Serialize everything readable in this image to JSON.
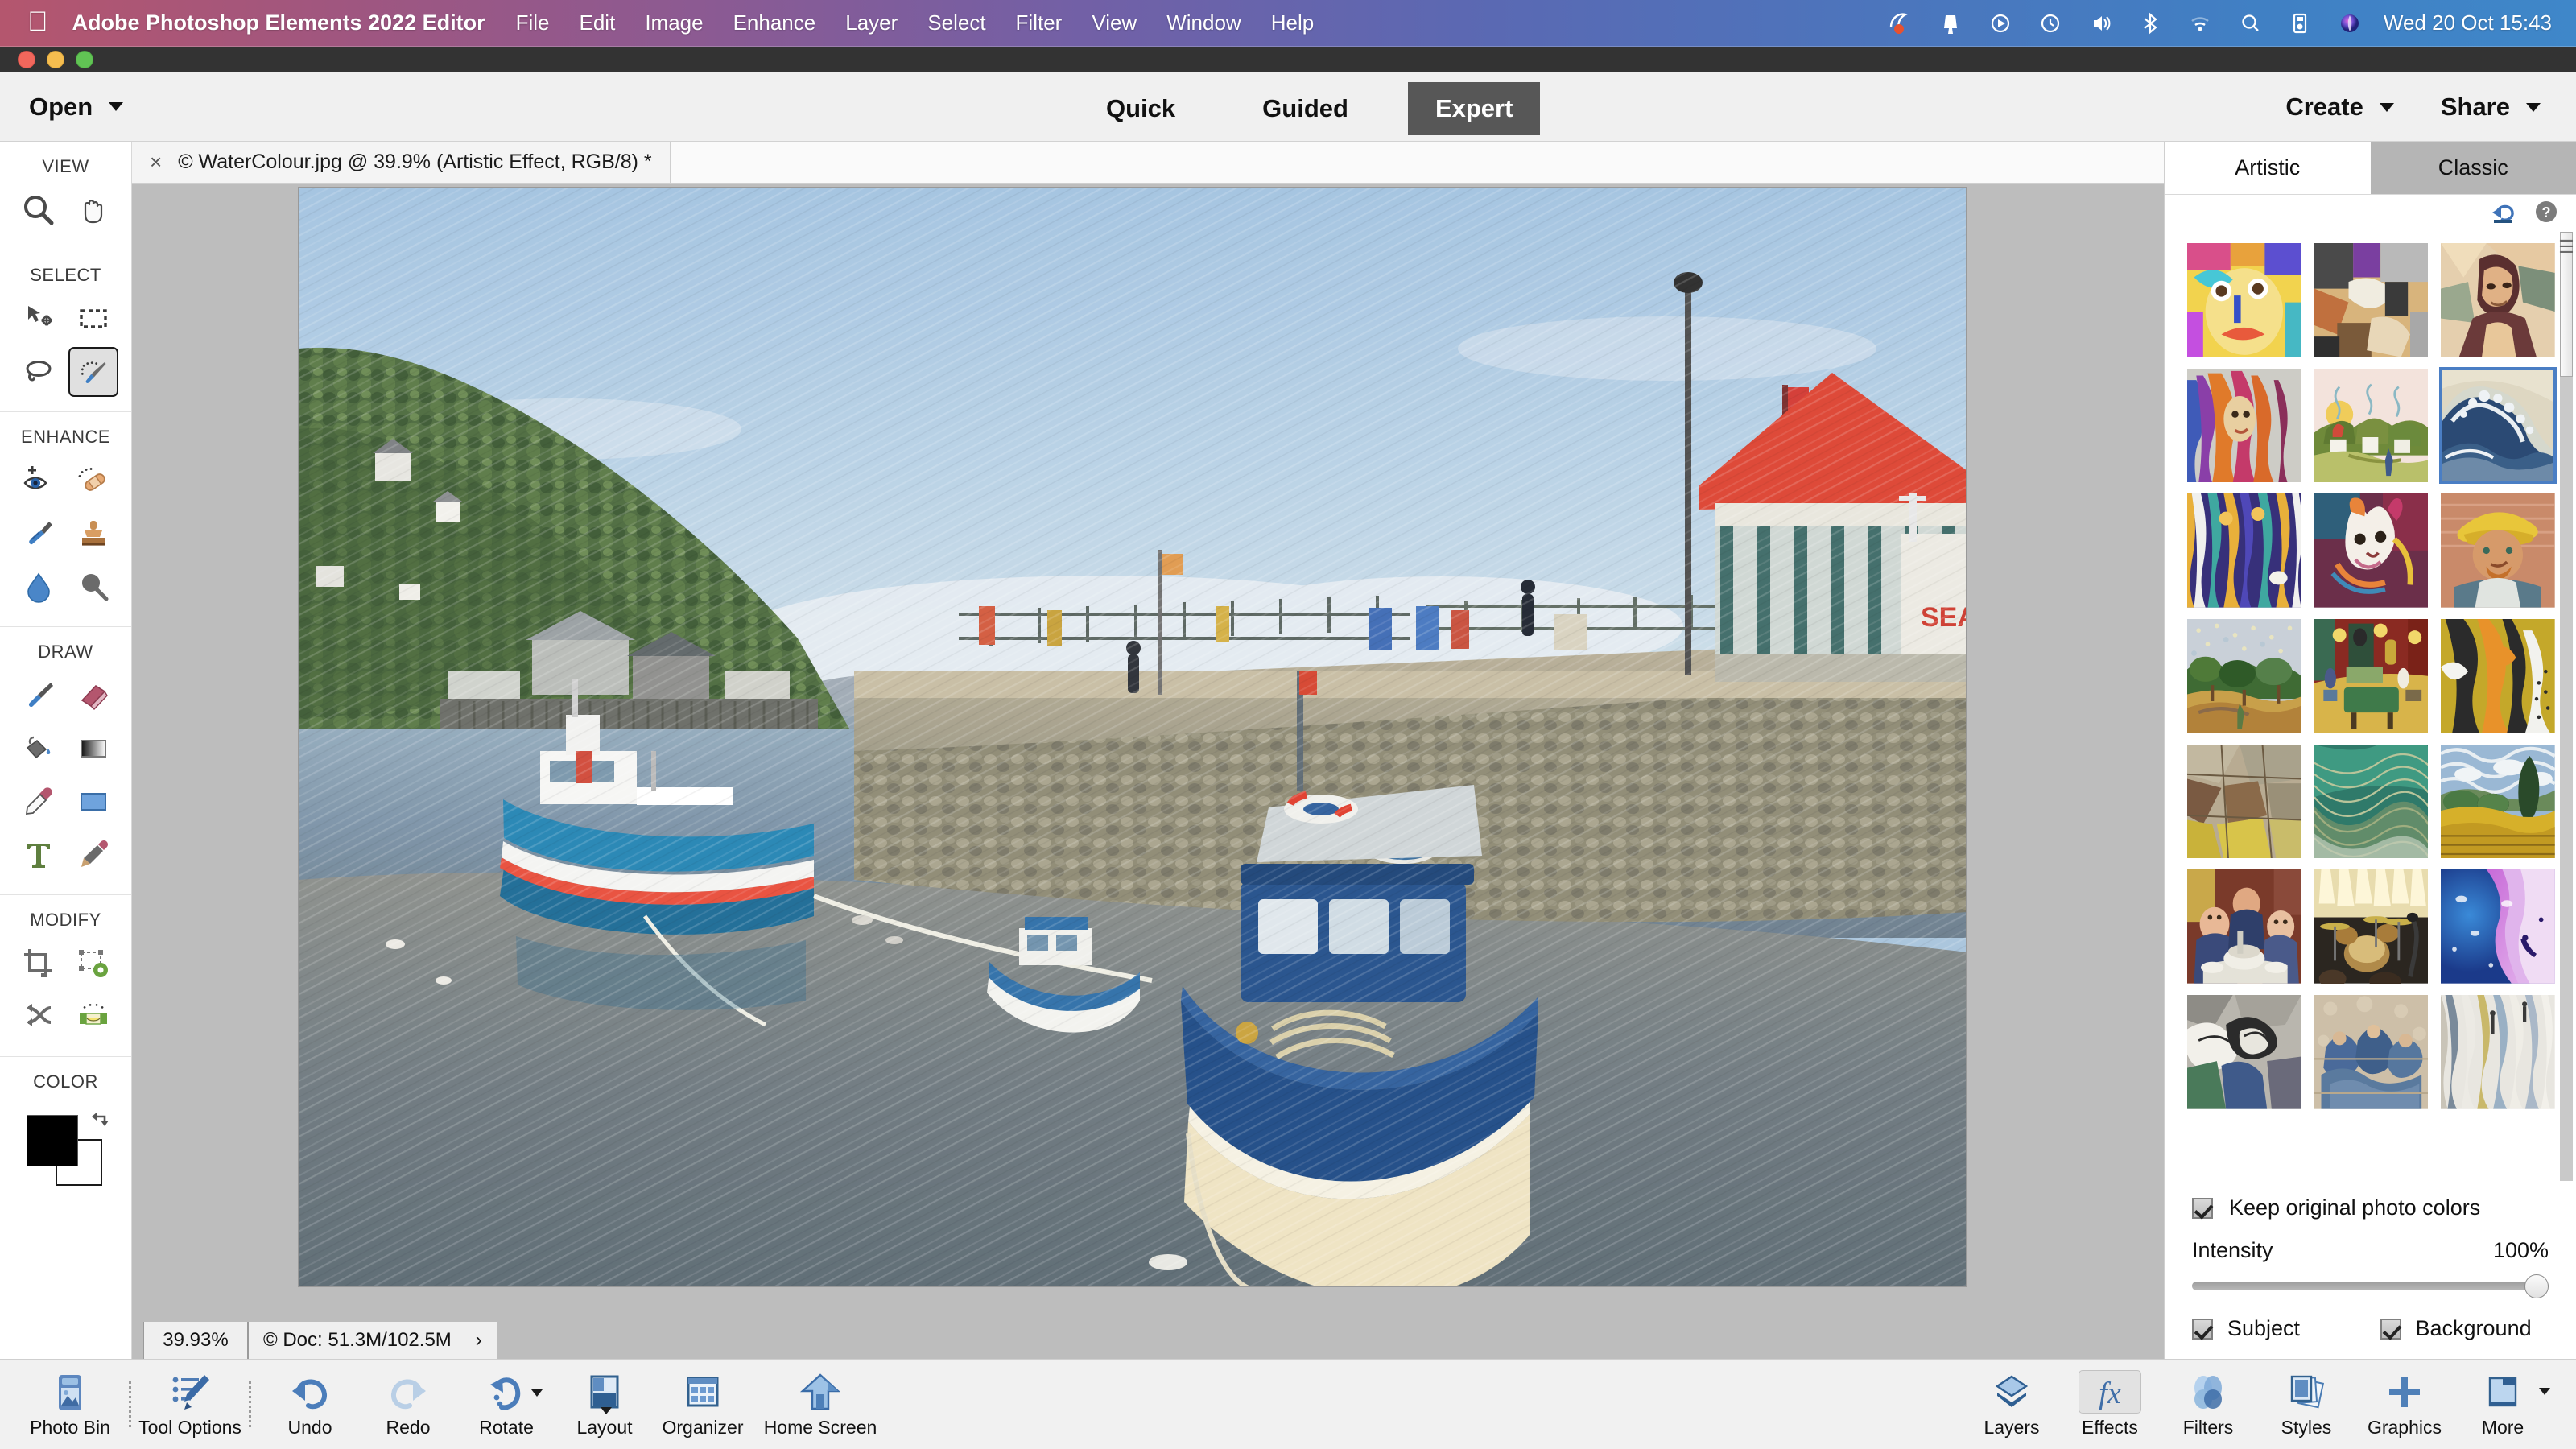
{
  "menubar": {
    "apple_icon": "apple-icon",
    "app_name": "Adobe Photoshop Elements 2022 Editor",
    "items": [
      "File",
      "Edit",
      "Image",
      "Enhance",
      "Layer",
      "Select",
      "Filter",
      "View",
      "Window",
      "Help"
    ],
    "status_icons": [
      "screen-record-icon",
      "notification-bell-icon",
      "play-circle-icon",
      "time-machine-icon",
      "volume-icon",
      "bluetooth-icon",
      "wifi-icon",
      "spotlight-search-icon",
      "display-icon",
      "siri-icon"
    ],
    "clock": "Wed 20 Oct  15:43"
  },
  "apptop": {
    "open_label": "Open",
    "modes": [
      {
        "label": "Quick",
        "selected": false
      },
      {
        "label": "Guided",
        "selected": false
      },
      {
        "label": "Expert",
        "selected": true
      }
    ],
    "create_label": "Create",
    "share_label": "Share"
  },
  "document": {
    "close_glyph": "×",
    "tab_title": "© WaterColour.jpg @ 39.9% (Artistic Effect, RGB/8) *"
  },
  "statusbar": {
    "zoom": "39.93%",
    "doc_info": "© Doc: 51.3M/102.5M",
    "expand_glyph": "›"
  },
  "toolbox": {
    "groups": [
      {
        "title": "VIEW",
        "tools": [
          {
            "name": "zoom-tool",
            "selected": false
          },
          {
            "name": "hand-tool",
            "selected": false
          }
        ]
      },
      {
        "title": "SELECT",
        "tools": [
          {
            "name": "move-tool",
            "selected": false
          },
          {
            "name": "rectangular-marquee-tool",
            "selected": false
          },
          {
            "name": "lasso-tool",
            "selected": false
          },
          {
            "name": "quick-selection-brush-tool",
            "selected": true
          }
        ]
      },
      {
        "title": "ENHANCE",
        "tools": [
          {
            "name": "red-eye-removal-tool",
            "selected": false
          },
          {
            "name": "spot-healing-brush-tool",
            "selected": false
          },
          {
            "name": "smart-brush-tool",
            "selected": false
          },
          {
            "name": "clone-stamp-tool",
            "selected": false
          },
          {
            "name": "blur-tool",
            "selected": false
          },
          {
            "name": "dodge-burn-tool",
            "selected": false
          }
        ]
      },
      {
        "title": "DRAW",
        "tools": [
          {
            "name": "brush-tool",
            "selected": false
          },
          {
            "name": "eraser-tool",
            "selected": false
          },
          {
            "name": "paint-bucket-tool",
            "selected": false
          },
          {
            "name": "gradient-tool",
            "selected": false
          },
          {
            "name": "eyedropper-tool",
            "selected": false
          },
          {
            "name": "shape-tool",
            "selected": false
          },
          {
            "name": "type-tool",
            "selected": false
          },
          {
            "name": "pencil-tool",
            "selected": false
          }
        ]
      },
      {
        "title": "MODIFY",
        "tools": [
          {
            "name": "crop-tool",
            "selected": false
          },
          {
            "name": "recompose-tool",
            "selected": false
          },
          {
            "name": "content-aware-move-tool",
            "selected": false
          },
          {
            "name": "straighten-tool",
            "selected": false
          }
        ]
      },
      {
        "title": "COLOR",
        "tools": []
      }
    ],
    "foreground_color": "#000000",
    "background_color": "#ffffff"
  },
  "rightpanel": {
    "tabs": [
      {
        "label": "Artistic",
        "selected": true
      },
      {
        "label": "Classic",
        "selected": false
      }
    ],
    "reset_icon": "undo-arrow-icon",
    "help_icon": "help-question-icon",
    "effects": [
      {
        "name": "cubist-face",
        "selected": false
      },
      {
        "name": "abstract-cubism",
        "selected": false
      },
      {
        "name": "mona-lisa-lowpoly",
        "selected": false
      },
      {
        "name": "expressive-portrait",
        "selected": false
      },
      {
        "name": "van-gogh-cottages",
        "selected": false
      },
      {
        "name": "the-great-wave",
        "selected": true
      },
      {
        "name": "abstract-figures",
        "selected": false
      },
      {
        "name": "colorful-dog",
        "selected": false
      },
      {
        "name": "van-gogh-self-portrait",
        "selected": false
      },
      {
        "name": "pointillist-olive-trees",
        "selected": false
      },
      {
        "name": "night-cafe",
        "selected": false
      },
      {
        "name": "penguin-graphic",
        "selected": false
      },
      {
        "name": "cubist-earth-tones",
        "selected": false
      },
      {
        "name": "green-swirl",
        "selected": false
      },
      {
        "name": "wheat-field-cypresses",
        "selected": false
      },
      {
        "name": "children-at-table",
        "selected": false
      },
      {
        "name": "drum-stage",
        "selected": false
      },
      {
        "name": "fluid-acrylic-pour",
        "selected": false
      },
      {
        "name": "futurist-abstract",
        "selected": false
      },
      {
        "name": "degas-blue-dancers",
        "selected": false
      },
      {
        "name": "textured-white-abstract",
        "selected": false
      }
    ],
    "keep_colors_label": "Keep original photo colors",
    "keep_colors_checked": true,
    "intensity_label": "Intensity",
    "intensity_value": "100%",
    "intensity_percent": 100,
    "subject_label": "Subject",
    "subject_checked": true,
    "background_label": "Background",
    "background_checked": true
  },
  "taskbar": {
    "left": [
      {
        "label": "Photo Bin",
        "icon": "photo-bin-icon",
        "caret": false,
        "boxed": false
      },
      {
        "label": "Tool Options",
        "icon": "tool-options-icon",
        "caret": false,
        "boxed": false
      },
      {
        "label": "Undo",
        "icon": "undo-icon",
        "caret": false,
        "boxed": false
      },
      {
        "label": "Redo",
        "icon": "redo-icon",
        "caret": false,
        "boxed": false
      },
      {
        "label": "Rotate",
        "icon": "rotate-icon",
        "caret": true,
        "boxed": false
      },
      {
        "label": "Layout",
        "icon": "layout-icon",
        "caret": true,
        "boxed": false
      },
      {
        "label": "Organizer",
        "icon": "organizer-icon",
        "caret": false,
        "boxed": false
      },
      {
        "label": "Home Screen",
        "icon": "home-screen-icon",
        "caret": false,
        "boxed": false
      }
    ],
    "right": [
      {
        "label": "Layers",
        "icon": "layers-icon",
        "caret": false,
        "boxed": false
      },
      {
        "label": "Effects",
        "icon": "effects-fx-icon",
        "caret": false,
        "boxed": true
      },
      {
        "label": "Filters",
        "icon": "filters-icon",
        "caret": false,
        "boxed": false
      },
      {
        "label": "Styles",
        "icon": "styles-icon",
        "caret": false,
        "boxed": false
      },
      {
        "label": "Graphics",
        "icon": "graphics-plus-icon",
        "caret": false,
        "boxed": false
      },
      {
        "label": "More",
        "icon": "more-icon",
        "caret": true,
        "boxed": false
      }
    ]
  },
  "colors": {
    "accent_blue": "#4a7ec4",
    "mode_selected_bg": "#575757",
    "canvas_bg": "#bdbdbd"
  }
}
